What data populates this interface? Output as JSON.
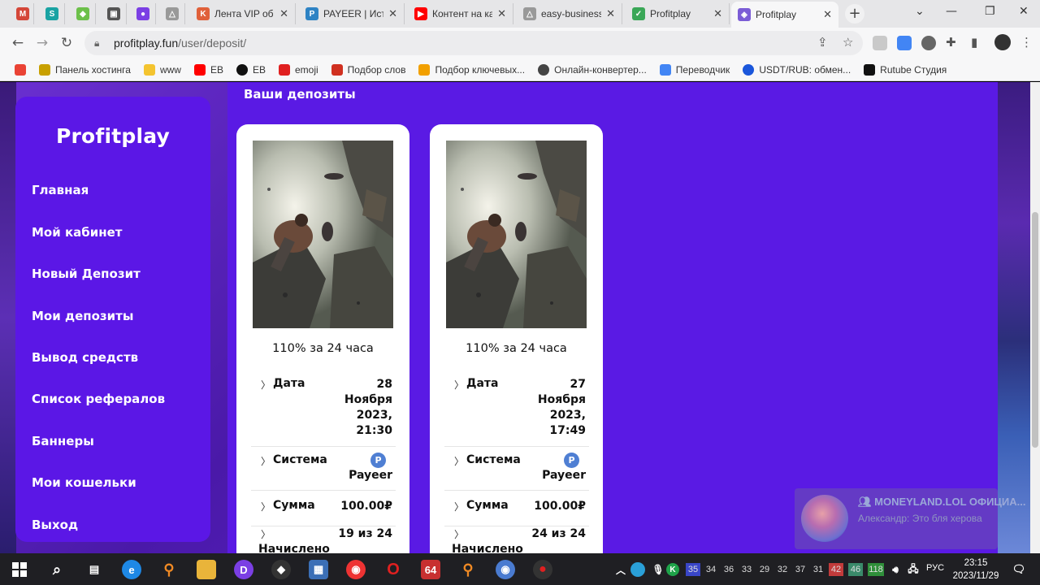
{
  "browser": {
    "tabs": [
      {
        "title": "",
        "favicon_color": "#d44638",
        "favicon": "gmail-icon"
      },
      {
        "title": "",
        "favicon_color": "#1aa3a3",
        "favicon": "s-icon"
      },
      {
        "title": "",
        "favicon_color": "#6cc04a",
        "favicon": "android-icon"
      },
      {
        "title": "",
        "favicon_color": "#555555",
        "favicon": "image-icon"
      },
      {
        "title": "",
        "favicon_color": "#7b3fe4",
        "favicon": "chat-icon"
      },
      {
        "title": "",
        "favicon_color": "#888888",
        "favicon": "mountain-icon"
      },
      {
        "title": "Лента VIP об",
        "favicon_color": "#e0603a",
        "favicon": "k-icon"
      },
      {
        "title": "PAYEER | Исто",
        "favicon_color": "#2e83c4",
        "favicon": "payeer-icon"
      },
      {
        "title": "Контент на ка",
        "favicon_color": "#ff0000",
        "favicon": "youtube-icon"
      },
      {
        "title": "easy-business",
        "favicon_color": "#888888",
        "favicon": "mountain-icon"
      },
      {
        "title": "Profitplay",
        "favicon_color": "#3aa757",
        "favicon": "check-icon"
      },
      {
        "title": "Profitplay",
        "favicon_color": "#7b5cd6",
        "favicon": "gamepad-icon"
      }
    ],
    "url_host": "profitplay.fun",
    "url_path": "/user/deposit/",
    "bookmarks": [
      {
        "label": "Панель хостинга",
        "color": "#c8a000"
      },
      {
        "label": "www",
        "color": "#f4c430"
      },
      {
        "label": "EB",
        "color": "#ff0000"
      },
      {
        "label": "EB",
        "color": "#111111"
      },
      {
        "label": "emoji",
        "color": "#e02020"
      },
      {
        "label": "Подбор слов",
        "color": "#d03020"
      },
      {
        "label": "Подбор ключевых...",
        "color": "#f2a000"
      },
      {
        "label": "Онлайн-конвертер...",
        "color": "#444444"
      },
      {
        "label": "Переводчик",
        "color": "#4285f4"
      },
      {
        "label": "USDT/RUB: обмен...",
        "color": "#1a56db"
      },
      {
        "label": "Rutube Студия",
        "color": "#111111"
      }
    ]
  },
  "site": {
    "brand": "Profitplay",
    "menu": [
      "Главная",
      "Мой кабинет",
      "Новый Депозит",
      "Мои депозиты",
      "Вывод средств",
      "Список рефералов",
      "Баннеры",
      "Мои кошельки",
      "Выход"
    ],
    "section_title": "Ваши депозиты",
    "deposits": [
      {
        "plan": "110% за 24 часа",
        "date_label": "Дата",
        "date_lines": [
          "28",
          "Ноября",
          "2023,",
          "21:30"
        ],
        "system_label": "Система",
        "system_value": "Payeer",
        "amount_label": "Сумма",
        "amount_value": "100.00₽",
        "accrued_label": "Начислено",
        "accrued_value": "19 из 24"
      },
      {
        "plan": "110% за 24 часа",
        "date_label": "Дата",
        "date_lines": [
          "27",
          "Ноября",
          "2023,",
          "17:49"
        ],
        "system_label": "Система",
        "system_value": "Payeer",
        "amount_label": "Сумма",
        "amount_value": "100.00₽",
        "accrued_label": "Начислено",
        "accrued_value": "24 из 24"
      }
    ],
    "payeer_badge": "P",
    "colors": {
      "panel": "#5a1ae4",
      "sidebar": "#5b17e6",
      "card": "#ffffff"
    }
  },
  "notification": {
    "channel": "MONEYLAND.LOL ОФИЦИА...",
    "message": "Александр: Это бля херова"
  },
  "taskbar": {
    "tray_numbers": [
      "35",
      "34",
      "36",
      "33",
      "29",
      "32",
      "37",
      "31",
      "42",
      "46",
      "118"
    ],
    "language": "РУС",
    "time": "23:15",
    "date": "2023/11/29",
    "app_badge": "64"
  }
}
